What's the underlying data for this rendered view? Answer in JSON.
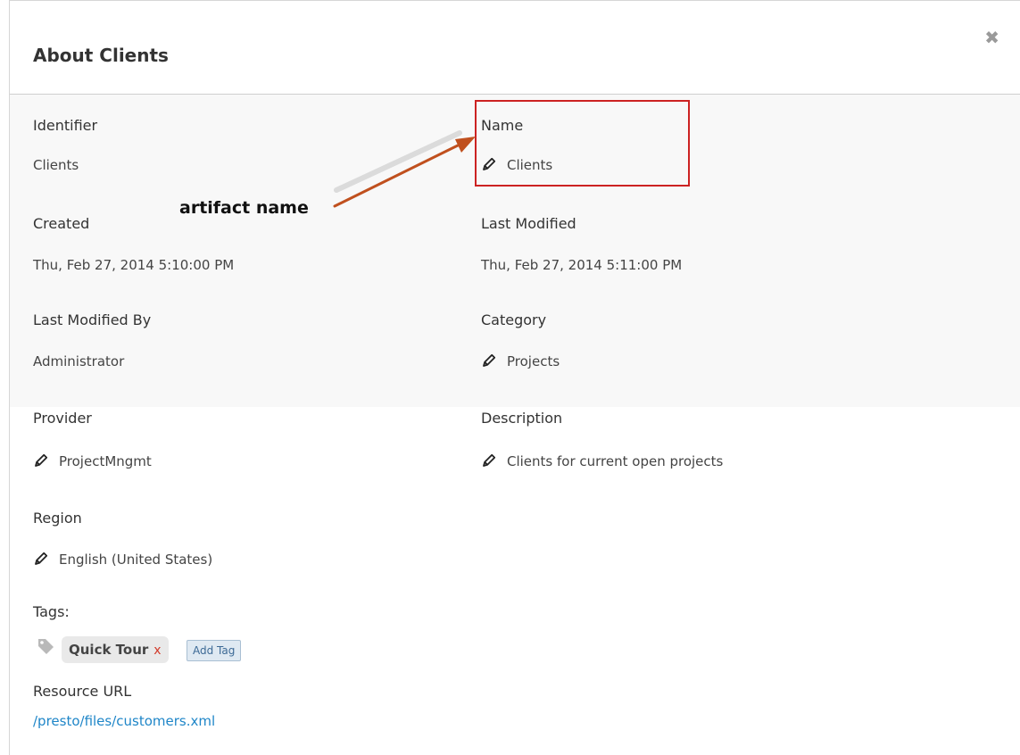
{
  "dialog": {
    "title": "About Clients",
    "close_label": "✖"
  },
  "fields": {
    "identifier": {
      "label": "Identifier",
      "value": "Clients"
    },
    "name": {
      "label": "Name",
      "value": "Clients"
    },
    "created": {
      "label": "Created",
      "value": "Thu, Feb 27, 2014 5:10:00 PM"
    },
    "last_modified": {
      "label": "Last Modified",
      "value": "Thu, Feb 27, 2014 5:11:00 PM"
    },
    "last_modified_by": {
      "label": "Last Modified By",
      "value": "Administrator"
    },
    "category": {
      "label": "Category",
      "value": "Projects"
    },
    "provider": {
      "label": "Provider",
      "value": "ProjectMngmt"
    },
    "description": {
      "label": "Description",
      "value": "Clients for current open projects"
    },
    "region": {
      "label": "Region",
      "value": "English (United States)"
    }
  },
  "tags": {
    "label": "Tags:",
    "items": [
      {
        "label": "Quick Tour",
        "remove_label": "x"
      }
    ],
    "add_label": "Add Tag"
  },
  "resource_url": {
    "label": "Resource URL",
    "value": "/presto/files/customers.xml"
  },
  "annotation": {
    "text": "artifact name",
    "color": "#c0392b"
  },
  "icons": {
    "edit": "pencil-icon",
    "tag": "tag-icon",
    "close": "close-icon"
  },
  "colors": {
    "link": "#1f86c8",
    "callout_border": "#cc2222",
    "arrow": "#c0501e"
  }
}
